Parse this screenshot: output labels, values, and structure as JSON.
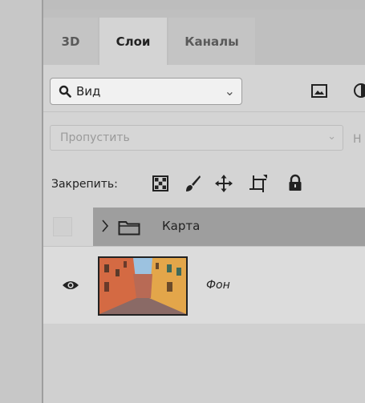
{
  "tabs": [
    {
      "label": "3D",
      "active": false
    },
    {
      "label": "Слои",
      "active": true
    },
    {
      "label": "Каналы",
      "active": false
    }
  ],
  "filter": {
    "label": "Вид",
    "search_icon": "search-icon",
    "dropdown_icon": "chevron-down-icon"
  },
  "blend_mode": {
    "value": "Пропустить",
    "opacity_label_partial": "Н"
  },
  "lock": {
    "label": "Закрепить:",
    "icons": [
      "lock-transparent-pixels-icon",
      "lock-image-pixels-icon",
      "lock-position-icon",
      "lock-artboard-icon",
      "lock-all-icon"
    ]
  },
  "layers": [
    {
      "name": "Карта",
      "type": "group",
      "visible": false,
      "selected": true
    },
    {
      "name": "Фон",
      "type": "image",
      "visible": true,
      "selected": false
    }
  ],
  "colors": {
    "panel": "#d4d4d4",
    "selected_row": "#9e9e9e",
    "background": "#b3b3b3"
  }
}
